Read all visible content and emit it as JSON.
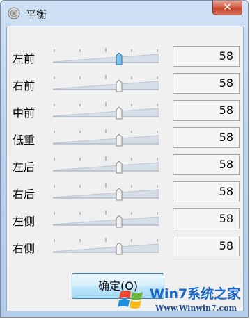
{
  "window": {
    "title": "平衡",
    "close_glyph": "✕"
  },
  "channels": [
    {
      "label": "左前",
      "value": "58",
      "level": 0.58,
      "focused": true
    },
    {
      "label": "右前",
      "value": "58",
      "level": 0.58,
      "focused": false
    },
    {
      "label": "中前",
      "value": "58",
      "level": 0.58,
      "focused": false
    },
    {
      "label": "低重",
      "value": "58",
      "level": 0.58,
      "focused": false
    },
    {
      "label": "左后",
      "value": "58",
      "level": 0.58,
      "focused": false
    },
    {
      "label": "右后",
      "value": "58",
      "level": 0.58,
      "focused": false
    },
    {
      "label": "左侧",
      "value": "58",
      "level": 0.58,
      "focused": false
    },
    {
      "label": "右侧",
      "value": "58",
      "level": 0.58,
      "focused": false
    }
  ],
  "ok_button": {
    "label": "确定(O)"
  },
  "watermark": {
    "brand": "Win7系统之家",
    "url": "Www.Winwin7.com"
  },
  "icons": {
    "title": "speaker-icon",
    "close": "close-icon",
    "logo": "windows-logo-icon"
  },
  "colors": {
    "close": "#c4432a",
    "accent": "#3c7fb1",
    "thumb_focused": "#7cc3ee"
  }
}
